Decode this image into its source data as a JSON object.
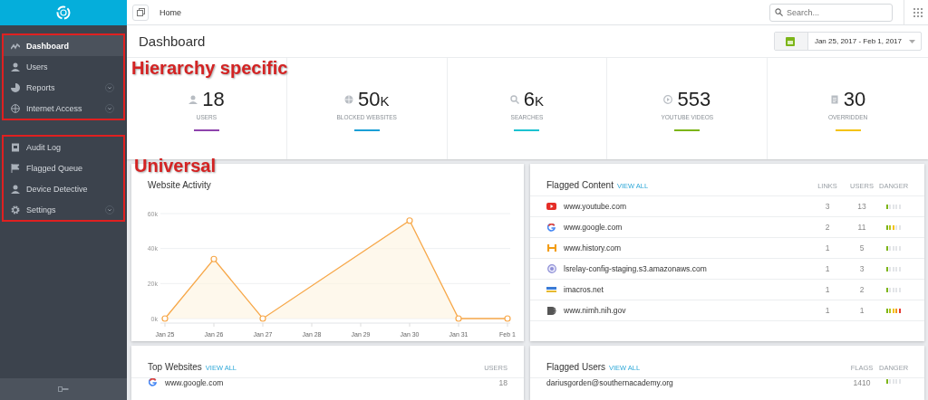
{
  "topbar": {
    "breadcrumb": "Home",
    "search": {
      "placeholder": "Search..."
    }
  },
  "sidebar": {
    "groups": [
      {
        "items": [
          {
            "label": "Dashboard",
            "selected": true,
            "has_submenu": false
          },
          {
            "label": "Users",
            "selected": false,
            "has_submenu": false
          },
          {
            "label": "Reports",
            "selected": false,
            "has_submenu": true
          },
          {
            "label": "Internet Access",
            "selected": false,
            "has_submenu": true
          }
        ]
      },
      {
        "items": [
          {
            "label": "Audit Log",
            "selected": false,
            "has_submenu": false
          },
          {
            "label": "Flagged Queue",
            "selected": false,
            "has_submenu": false
          },
          {
            "label": "Device Detective",
            "selected": false,
            "has_submenu": false
          },
          {
            "label": "Settings",
            "selected": false,
            "has_submenu": true
          }
        ]
      }
    ]
  },
  "annotations": [
    {
      "text": "Hierarchy specific"
    },
    {
      "text": "Universal"
    }
  ],
  "page": {
    "title": "Dashboard",
    "date_range": "Jan 25, 2017 - Feb 1, 2017"
  },
  "stats": [
    {
      "value": "18",
      "label": "USERS",
      "color": "#8e44ad"
    },
    {
      "value": "50",
      "suffix": "K",
      "label": "BLOCKED WEBSITES",
      "color": "#1a9fd6"
    },
    {
      "value": "6",
      "suffix": "K",
      "label": "SEARCHES",
      "color": "#1cc2d1"
    },
    {
      "value": "553",
      "label": "YOUTUBE VIDEOS",
      "color": "#7cb518"
    },
    {
      "value": "30",
      "label": "OVERRIDDEN",
      "color": "#f4c20d"
    }
  ],
  "website_activity": {
    "title": "Website Activity",
    "chart_data": {
      "type": "area",
      "categories": [
        "Jan 25",
        "Jan 26",
        "Jan 27",
        "Jan 28",
        "Jan 29",
        "Jan 30",
        "Jan 31",
        "Feb 1"
      ],
      "series": [
        {
          "color": "#f7a84a",
          "values": [
            0,
            34000,
            0,
            null,
            null,
            56000,
            0,
            0
          ]
        }
      ],
      "ylim": [
        0,
        60000
      ],
      "yticks": [
        {
          "value": 0,
          "label": "0k"
        },
        {
          "value": 20000,
          "label": "20k"
        },
        {
          "value": 40000,
          "label": "40k"
        },
        {
          "value": 60000,
          "label": "60k"
        }
      ]
    }
  },
  "flagged_content": {
    "title": "Flagged Content",
    "link": "VIEW ALL",
    "columns": [
      "LINKS",
      "USERS",
      "DANGER"
    ],
    "rows": [
      {
        "site": "www.youtube.com",
        "links": "3",
        "users": "13",
        "level": 0.2
      },
      {
        "site": "www.google.com",
        "links": "2",
        "users": "11",
        "level": 0.6
      },
      {
        "site": "www.history.com",
        "links": "1",
        "users": "5",
        "level": 0.2
      },
      {
        "site": "lsrelay-config-staging.s3.amazonaws.com",
        "links": "1",
        "users": "3",
        "level": 0.2
      },
      {
        "site": "imacros.net",
        "links": "1",
        "users": "2",
        "level": 0.2
      },
      {
        "site": "www.nimh.nih.gov",
        "links": "1",
        "users": "1",
        "level": 1.0
      }
    ]
  },
  "top_websites": {
    "title": "Top Websites",
    "link": "VIEW ALL",
    "columns": [
      "USERS"
    ],
    "rows": [
      {
        "site": "www.google.com",
        "users": "18"
      }
    ]
  },
  "flagged_users": {
    "title": "Flagged Users",
    "link": "VIEW ALL",
    "columns": [
      "FLAGS",
      "DANGER"
    ],
    "rows": [
      {
        "user": "dariusgorden@southernacademy.org",
        "flags": "1410",
        "level": 0.2
      }
    ]
  }
}
